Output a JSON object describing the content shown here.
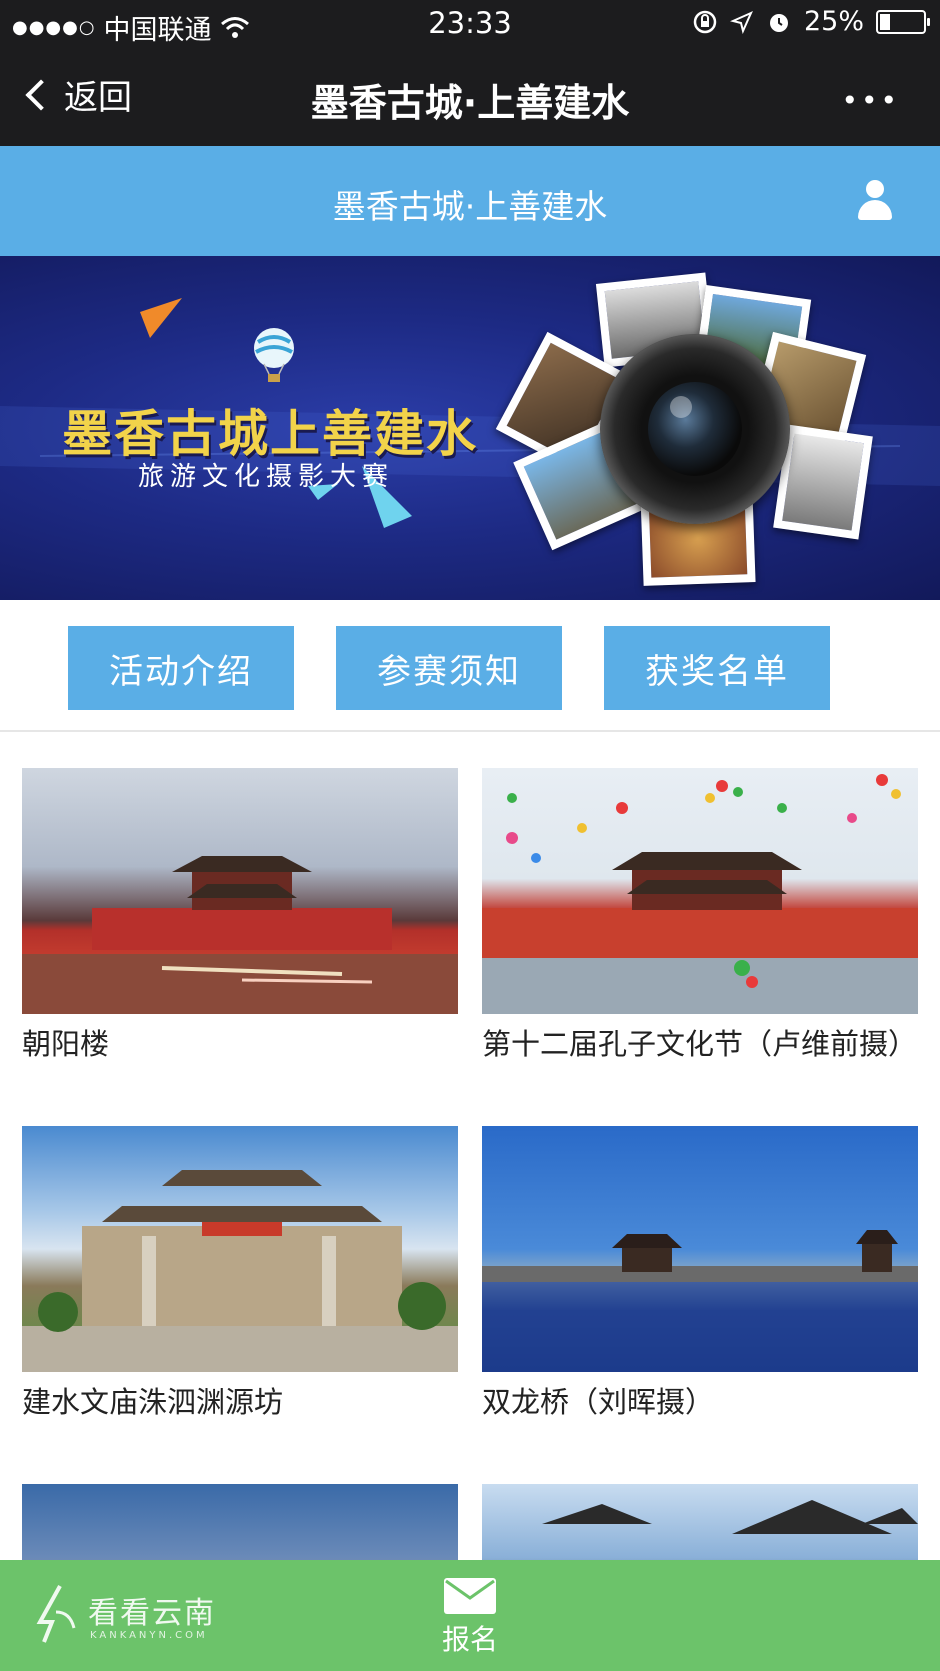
{
  "status_bar": {
    "signal": "●●●●○",
    "carrier": "中国联通",
    "time": "23:33",
    "battery": "25%"
  },
  "nav": {
    "back_label": "返回",
    "title": "墨香古城·上善建水",
    "more_label": "•••"
  },
  "header": {
    "title": "墨香古城·上善建水"
  },
  "banner": {
    "title": "墨香古城上善建水",
    "subtitle": "旅游文化摄影大赛"
  },
  "tabs": [
    {
      "label": "活动介绍"
    },
    {
      "label": "参赛须知"
    },
    {
      "label": "获奖名单"
    }
  ],
  "gallery": [
    {
      "caption": "朝阳楼"
    },
    {
      "caption": "第十二届孔子文化节（卢维前摄）"
    },
    {
      "caption": "建水文庙洙泗渊源坊"
    },
    {
      "caption": "双龙桥（刘晖摄）"
    },
    {
      "caption": ""
    },
    {
      "caption": ""
    }
  ],
  "bottom_bar": {
    "signup_label": "报名",
    "watermark_text": "看看云南",
    "watermark_sub": "KANKANYN.COM"
  },
  "colors": {
    "nav_bg": "#1c1c1e",
    "header_blue": "#5aaee6",
    "bottom_green": "#6cc36a",
    "banner_navy": "#1d2a84",
    "banner_title_gold": "#f2d34a"
  }
}
